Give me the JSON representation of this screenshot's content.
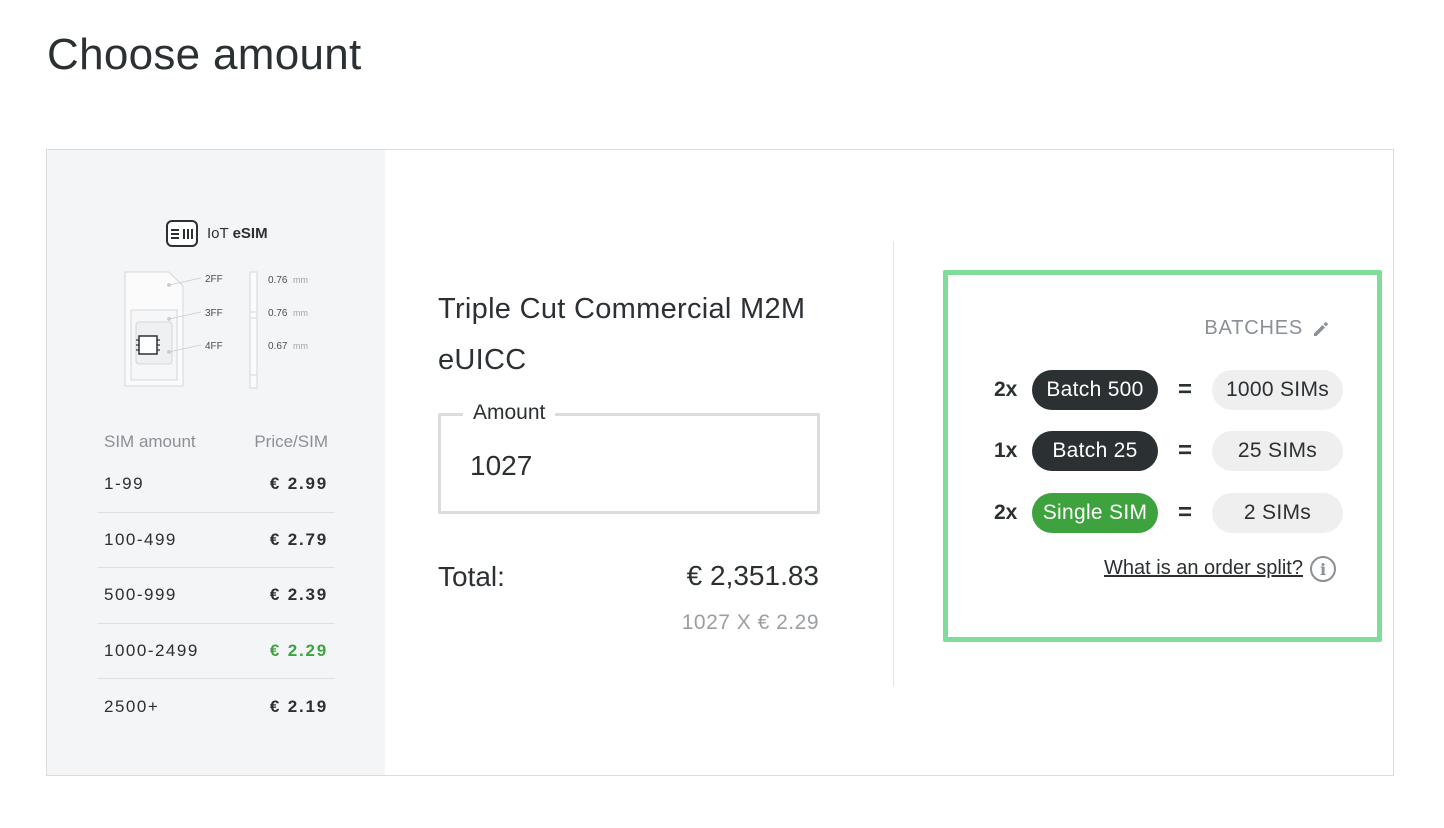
{
  "page": {
    "title": "Choose amount"
  },
  "brand": {
    "prefix": "IoT",
    "name": "eSIM"
  },
  "sim_diagram": {
    "formats": [
      "2FF",
      "3FF",
      "4FF"
    ],
    "thickness": [
      {
        "value": "0.76",
        "unit": "mm"
      },
      {
        "value": "0.76",
        "unit": "mm"
      },
      {
        "value": "0.67",
        "unit": "mm"
      }
    ]
  },
  "pricing": {
    "col_amount": "SIM amount",
    "col_price": "Price/SIM",
    "rows": [
      {
        "range": "1-99",
        "price": "€ 2.99",
        "active": false
      },
      {
        "range": "100-499",
        "price": "€ 2.79",
        "active": false
      },
      {
        "range": "500-999",
        "price": "€ 2.39",
        "active": false
      },
      {
        "range": "1000-2499",
        "price": "€ 2.29",
        "active": true
      },
      {
        "range": "2500+",
        "price": "€ 2.19",
        "active": false
      }
    ]
  },
  "product": {
    "title": "Triple Cut Commercial M2M eUICC"
  },
  "amount": {
    "label": "Amount",
    "value": "1027"
  },
  "total": {
    "label": "Total:",
    "value": "€ 2,351.83",
    "breakdown": "1027 X  € 2.29"
  },
  "batches": {
    "heading": "BATCHES",
    "rows": [
      {
        "multiplier": "2x",
        "name": "Batch 500",
        "equals": "=",
        "result": "1000 SIMs",
        "color": "#2b3033"
      },
      {
        "multiplier": "1x",
        "name": "Batch 25",
        "equals": "=",
        "result": "25 SIMs",
        "color": "#2b3033"
      },
      {
        "multiplier": "2x",
        "name": "Single SIM",
        "equals": "=",
        "result": "2 SIMs",
        "color": "#3ea33e"
      }
    ],
    "split_link": "What is an order split?"
  },
  "colors": {
    "accent_green": "#3ea33e",
    "highlight_border": "#7fdc9a",
    "dark": "#2b3033"
  }
}
